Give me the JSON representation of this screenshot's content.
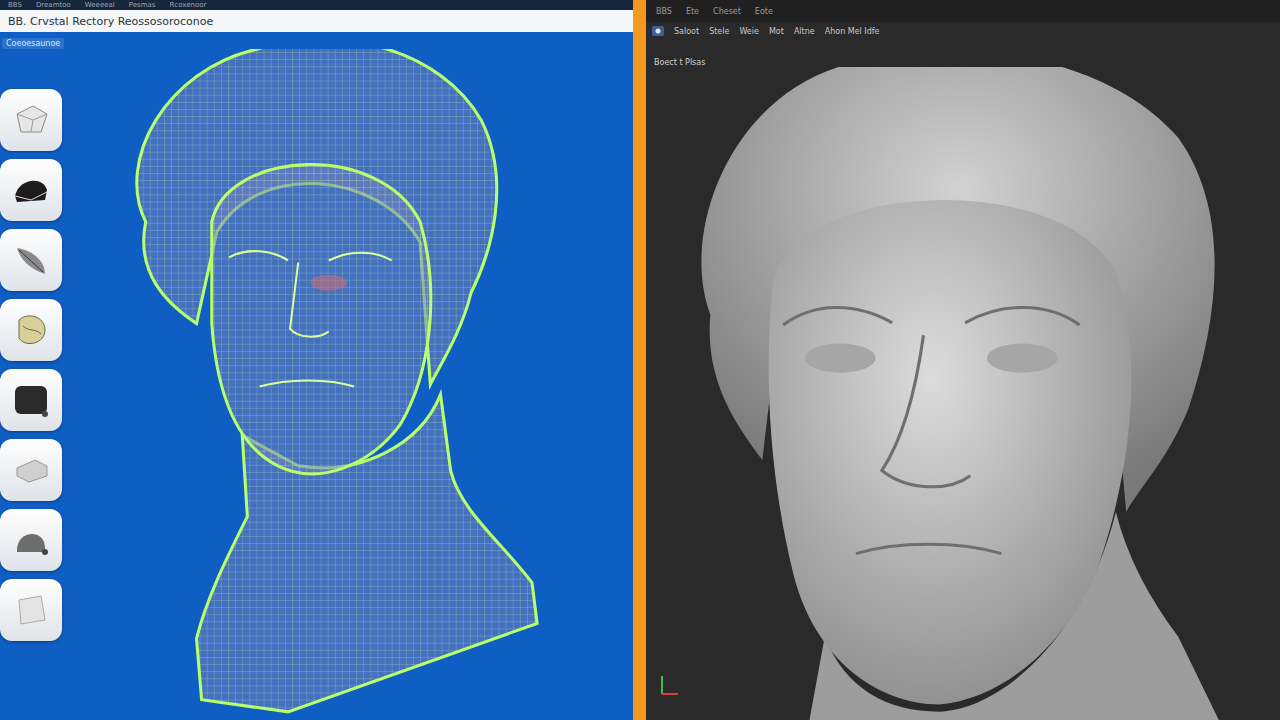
{
  "left_window": {
    "menu": [
      "BBS",
      "Dreamtoo",
      "Weeeeal",
      "Pesmas",
      "Rcoxenoor"
    ],
    "title": "BB. Crvstal Rectory  Reossosoroconoe",
    "label": "Coeoesaunoe"
  },
  "right_window": {
    "menu": [
      "BBS",
      "Ete",
      "Cheset",
      "Eote"
    ],
    "toolbar": [
      "Saloot",
      "Stele",
      "Weie",
      "Mot",
      "Altne",
      "Ahon Mel Idfe"
    ],
    "label": "Boect t Plsas"
  }
}
